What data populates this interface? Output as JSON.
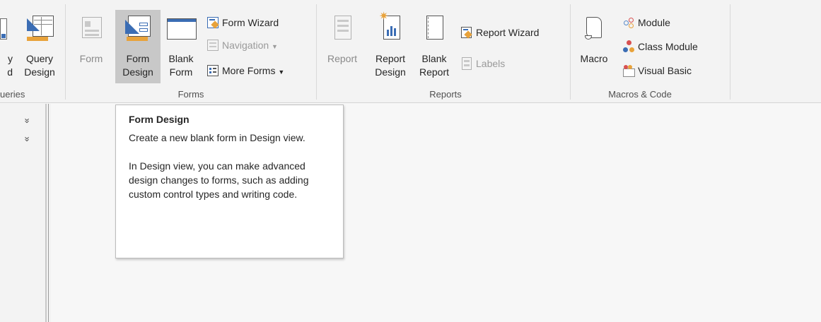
{
  "ribbon": {
    "queries_group": {
      "partial_button_label_1": "y",
      "partial_button_label_2": "d",
      "query_design_line1": "Query",
      "query_design_line2": "Design",
      "group_label": "ueries"
    },
    "forms_group": {
      "form_label": "Form",
      "form_design_line1": "Form",
      "form_design_line2": "Design",
      "blank_form_line1": "Blank",
      "blank_form_line2": "Form",
      "form_wizard": "Form Wizard",
      "navigation": "Navigation",
      "more_forms": "More Forms",
      "group_label": "Forms"
    },
    "reports_group": {
      "report_label": "Report",
      "report_design_line1": "Report",
      "report_design_line2": "Design",
      "blank_report_line1": "Blank",
      "blank_report_line2": "Report",
      "report_wizard": "Report Wizard",
      "labels": "Labels",
      "group_label": "Reports"
    },
    "macros_group": {
      "macro_label": "Macro",
      "module": "Module",
      "class_module": "Class Module",
      "visual_basic": "Visual Basic",
      "group_label": "Macros & Code"
    }
  },
  "nav_pane": {
    "chevron_1": "»",
    "chevron_2": "»"
  },
  "tooltip": {
    "title": "Form Design",
    "description": "Create a new blank form in Design view.",
    "details": "In Design view, you can make advanced design changes to forms, such as adding custom control types and writing code."
  },
  "colors": {
    "accent_blue": "#3b6db4",
    "hover_gray": "#c8c8c8",
    "ribbon_bg": "#f3f3f3"
  }
}
